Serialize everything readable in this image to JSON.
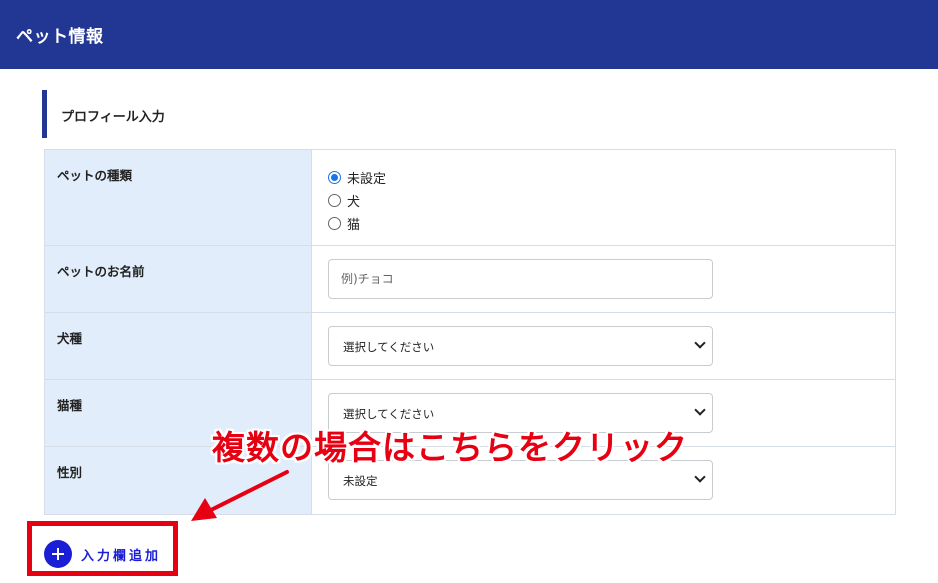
{
  "header": {
    "title": "ペット情報"
  },
  "section": {
    "title": "プロフィール入力"
  },
  "form": {
    "pet_type": {
      "label": "ペットの種類",
      "options": [
        {
          "label": "未設定",
          "checked": true
        },
        {
          "label": "犬",
          "checked": false
        },
        {
          "label": "猫",
          "checked": false
        }
      ]
    },
    "pet_name": {
      "label": "ペットのお名前",
      "placeholder": "例)チョコ",
      "value": ""
    },
    "dog_breed": {
      "label": "犬種",
      "selected": "選択してください"
    },
    "cat_breed": {
      "label": "猫種",
      "selected": "選択してください"
    },
    "sex": {
      "label": "性別",
      "selected": "未設定"
    }
  },
  "annotation": {
    "text": "複数の場合はこちらをクリック",
    "color": "#e60012"
  },
  "add_button": {
    "label": "入力欄追加",
    "icon": "plus-circle-icon"
  },
  "colors": {
    "header": "#223694",
    "label_bg": "#e1edfa",
    "accent_blue": "#1a1fd6",
    "highlight_red": "#e60012"
  }
}
